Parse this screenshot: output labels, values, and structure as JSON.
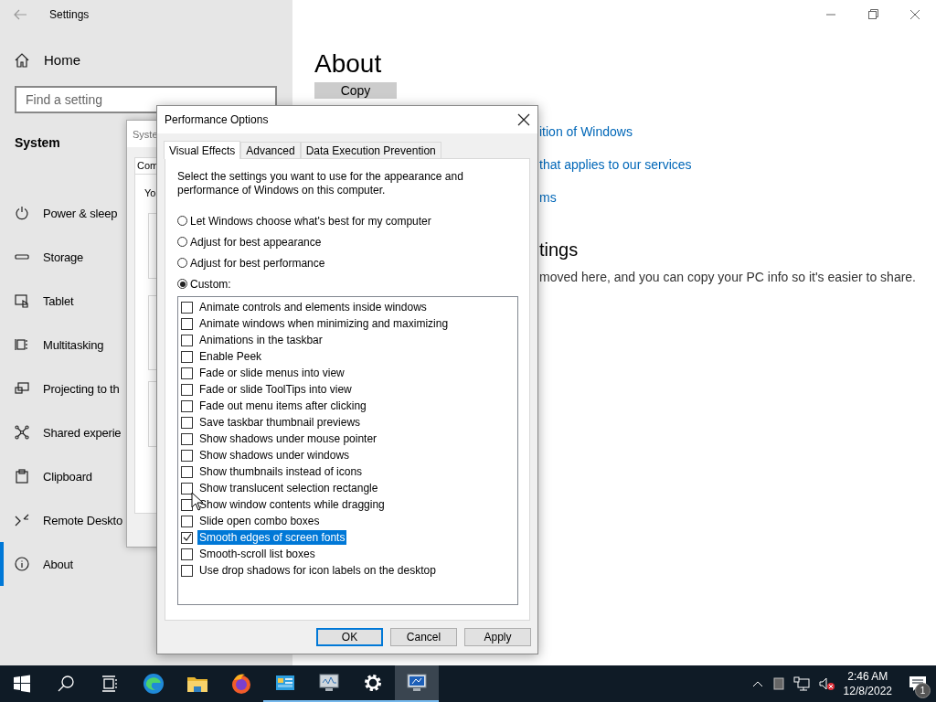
{
  "settings": {
    "title": "Settings",
    "home": "Home",
    "search": {
      "placeholder": "Find a setting"
    },
    "section": "System",
    "nav": [
      {
        "label": "Power & sleep",
        "selected": false
      },
      {
        "label": "Storage",
        "selected": false
      },
      {
        "label": "Tablet",
        "selected": false
      },
      {
        "label": "Multitasking",
        "selected": false
      },
      {
        "label": "Projecting to th",
        "selected": false
      },
      {
        "label": "Shared experie",
        "selected": false
      },
      {
        "label": "Clipboard",
        "selected": false
      },
      {
        "label": "Remote Deskto",
        "selected": false
      },
      {
        "label": "About",
        "selected": true
      }
    ],
    "page_title": "About",
    "copy_button": "Copy",
    "links": [
      "ition of Windows",
      "that applies to our services",
      "ms"
    ],
    "heading": "tings",
    "text": "moved here, and you can copy your PC info so it's easier to share."
  },
  "system_properties": {
    "title": "Syste",
    "tab": "Com",
    "text": "Yo"
  },
  "performance_options": {
    "title": "Performance Options",
    "tabs": [
      {
        "label": "Visual Effects",
        "selected": true
      },
      {
        "label": "Advanced",
        "selected": false
      },
      {
        "label": "Data Execution Prevention",
        "selected": false
      }
    ],
    "description": "Select the settings you want to use for the appearance and performance of Windows on this computer.",
    "options": [
      {
        "label": "Let Windows choose what's best for my computer",
        "selected": false
      },
      {
        "label": "Adjust for best appearance",
        "selected": false
      },
      {
        "label": "Adjust for best performance",
        "selected": false
      },
      {
        "label": "Custom:",
        "selected": true
      }
    ],
    "effects": [
      {
        "label": "Animate controls and elements inside windows",
        "checked": false,
        "selected": false
      },
      {
        "label": "Animate windows when minimizing and maximizing",
        "checked": false,
        "selected": false
      },
      {
        "label": "Animations in the taskbar",
        "checked": false,
        "selected": false
      },
      {
        "label": "Enable Peek",
        "checked": false,
        "selected": false
      },
      {
        "label": "Fade or slide menus into view",
        "checked": false,
        "selected": false
      },
      {
        "label": "Fade or slide ToolTips into view",
        "checked": false,
        "selected": false
      },
      {
        "label": "Fade out menu items after clicking",
        "checked": false,
        "selected": false
      },
      {
        "label": "Save taskbar thumbnail previews",
        "checked": false,
        "selected": false
      },
      {
        "label": "Show shadows under mouse pointer",
        "checked": false,
        "selected": false
      },
      {
        "label": "Show shadows under windows",
        "checked": false,
        "selected": false
      },
      {
        "label": "Show thumbnails instead of icons",
        "checked": false,
        "selected": false
      },
      {
        "label": "Show translucent selection rectangle",
        "checked": false,
        "selected": false
      },
      {
        "label": "Show window contents while dragging",
        "checked": false,
        "selected": false
      },
      {
        "label": "Slide open combo boxes",
        "checked": false,
        "selected": false
      },
      {
        "label": "Smooth edges of screen fonts",
        "checked": true,
        "selected": true
      },
      {
        "label": "Smooth-scroll list boxes",
        "checked": false,
        "selected": false
      },
      {
        "label": "Use drop shadows for icon labels on the desktop",
        "checked": false,
        "selected": false
      }
    ],
    "buttons": [
      {
        "label": "OK",
        "default": true
      },
      {
        "label": "Cancel",
        "default": false
      },
      {
        "label": "Apply",
        "default": false
      }
    ]
  },
  "taskbar": {
    "apps": [
      {
        "kind": "edge",
        "running": false,
        "active": false
      },
      {
        "kind": "folder",
        "running": false,
        "active": false
      },
      {
        "kind": "firefox",
        "running": false,
        "active": false
      },
      {
        "kind": "panel",
        "running": true,
        "active": false
      },
      {
        "kind": "monitor",
        "running": true,
        "active": false
      },
      {
        "kind": "gear",
        "running": true,
        "active": false
      },
      {
        "kind": "computer",
        "running": true,
        "active": true
      }
    ],
    "time": "2:46 AM",
    "date": "12/8/2022",
    "notifications": "1"
  }
}
